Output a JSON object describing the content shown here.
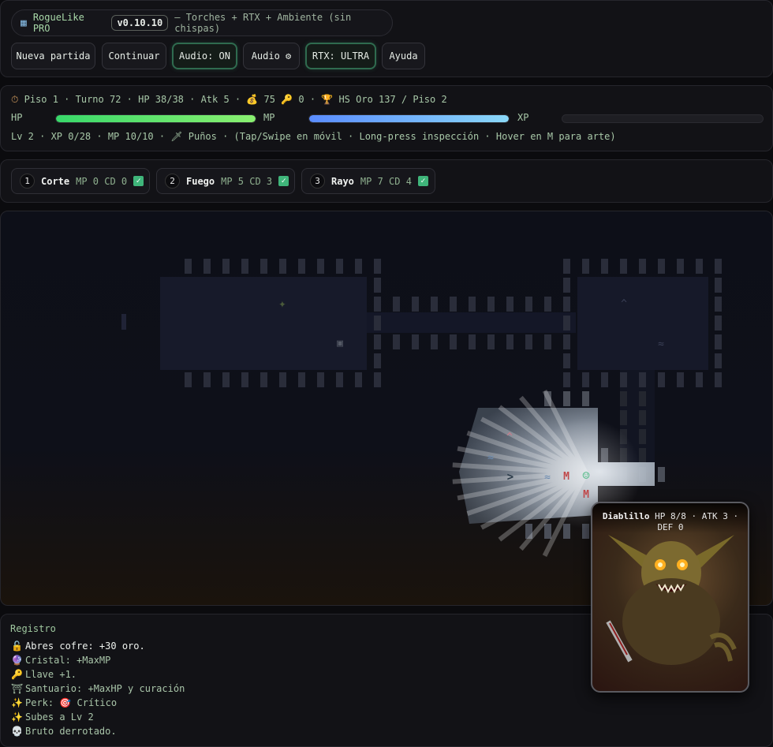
{
  "header": {
    "app_name": "RogueLike PRO",
    "version": "v0.10.10",
    "subtitle": "— Torches + RTX + Ambiente (sin chispas)",
    "buttons": {
      "new_game": "Nueva partida",
      "continue": "Continuar",
      "audio": "Audio: ON",
      "audio_settings": "Audio ⚙",
      "rtx": "RTX: ULTRA",
      "help": "Ayuda"
    }
  },
  "stats": {
    "status_line": "Piso 1 · Turno 72 · HP 38/38 · Atk 5 · 💰 75 🔑 0 · 🏆 HS Oro 137 / Piso 2",
    "hp_label": "HP",
    "mp_label": "MP",
    "xp_label": "XP",
    "hp_fraction": 1.0,
    "mp_fraction": 1.0,
    "xp_fraction": 0.0,
    "info_line": "Lv 2 · XP 0/28 · MP 10/10 · 🗡 Puños · (Tap/Swipe en móvil · Long-press inspección · Hover en M para arte)"
  },
  "skills": [
    {
      "key": "1",
      "name": "Corte",
      "meta": "MP 0 CD 0"
    },
    {
      "key": "2",
      "name": "Fuego",
      "meta": "MP 5 CD 3"
    },
    {
      "key": "3",
      "name": "Rayo",
      "meta": "MP 7 CD 4"
    }
  ],
  "map_glyphs": {
    "shrine": "✦",
    "chest": "▣",
    "trap": "^",
    "water": "≈",
    "stairs": ">",
    "monster": "M",
    "player": "☺"
  },
  "log": {
    "title": "Registro",
    "entries": [
      {
        "icon": "🔓",
        "text": "Abres cofre: +30 oro."
      },
      {
        "icon": "🔮",
        "text": "Cristal: +MaxMP"
      },
      {
        "icon": "🔑",
        "text": "Llave +1."
      },
      {
        "icon": "⛩",
        "text": "Santuario: +MaxHP y curación"
      },
      {
        "icon": "✨",
        "text": "Perk: 🎯 Crítico"
      },
      {
        "icon": "✨",
        "text": "Subes a Lv 2"
      },
      {
        "icon": "💀",
        "text": "Bruto derrotado."
      }
    ]
  },
  "monster_card": {
    "name": "Diablillo",
    "stats": "HP 8/8 · ATK 3 · DEF 0"
  },
  "colors": {
    "accent_green": "#3fb57a",
    "hp_bar": "#5ef06a",
    "mp_bar": "#6aa8ff",
    "monster_red": "#c0484a"
  }
}
